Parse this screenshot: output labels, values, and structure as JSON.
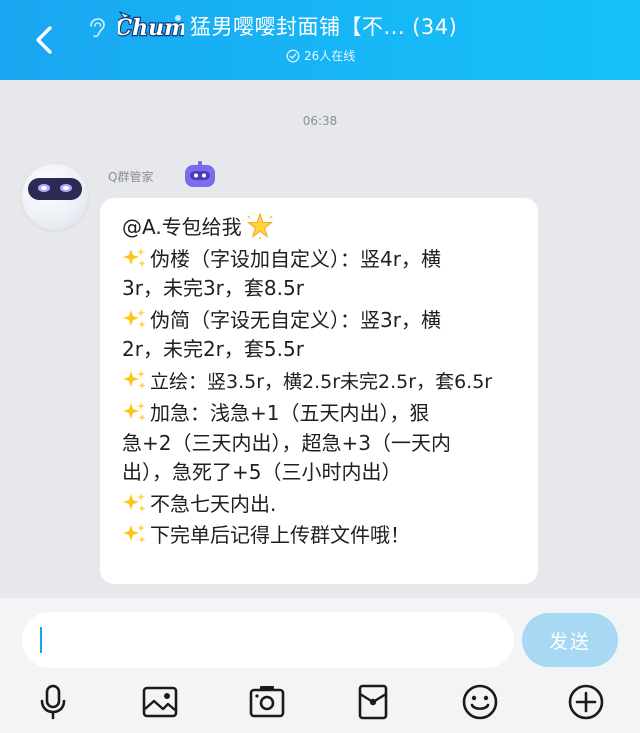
{
  "header": {
    "logo_text": "Chum",
    "title": "猛男嘤嘤封面铺【不... (34)",
    "online_count": "26人在线"
  },
  "chat": {
    "timestamp": "06:38",
    "sender_name": "Q群管家",
    "message": {
      "mention_line": "@A.专包给我",
      "paragraphs": [
        {
          "lines": [
            "伪楼（字设加自定义）：竖4r，横",
            "3r，未完3r，套8.5r"
          ]
        },
        {
          "lines": [
            "伪简（字设无自定义）：竖3r，横",
            "2r，未完2r，套5.5r"
          ]
        },
        {
          "lines": [
            "立绘：竖3.5r，横2.5r未完2.5r，套6.5r"
          ]
        },
        {
          "lines": [
            "加急：浅急+1（五天内出），狠",
            "急+2（三天内出），超急+3（一天内",
            "出），急死了+5（三小时内出）"
          ]
        },
        {
          "lines": [
            "不急七天内出."
          ]
        },
        {
          "lines": [
            "下完单后记得上传群文件哦！"
          ]
        }
      ]
    }
  },
  "input": {
    "value": "",
    "send_label": "发送"
  },
  "colors": {
    "header_start": "#19a6f0",
    "header_end": "#16c1f8",
    "send_button": "#a7d8f4",
    "background": "#e7e8ec",
    "bot_purple": "#7a6cf0"
  },
  "icons": {
    "back": "chevron-left-icon",
    "listen": "ear-icon",
    "online": "check-circle-icon",
    "bot": "robot-icon",
    "sparkle": "sparkles-icon",
    "glowing_star": "glowing-star-icon",
    "toolbar": [
      "microphone-icon",
      "image-icon",
      "camera-icon",
      "red-packet-icon",
      "emoji-icon",
      "plus-icon"
    ]
  }
}
